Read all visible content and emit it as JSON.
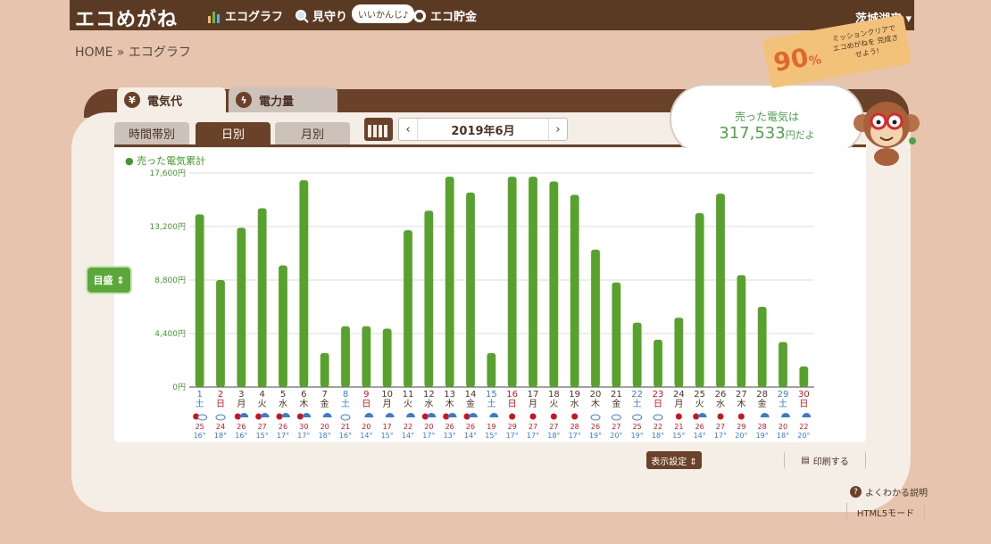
{
  "header": {
    "logo": "エコめがね",
    "nav": {
      "graph": "エコグラフ",
      "mimamori": "見守り",
      "mimamori_bubble": "いいかんじ♪",
      "savings": "エコ貯金"
    },
    "user": "茨城湖来 ▾"
  },
  "breadcrumb": "HOME » エコグラフ",
  "tabs": {
    "denki": "電気代",
    "power": "電力量"
  },
  "subtabs": {
    "time": "時間帯別",
    "day": "日別",
    "month": "月別"
  },
  "date_nav": {
    "prev": "‹",
    "label": "2019年6月",
    "next": "›"
  },
  "legend": "● 売った電気累計",
  "mokumori": "目盛 ⇕",
  "summary": {
    "line1": "売った電気は",
    "amount": "317,533",
    "unit": "円だよ"
  },
  "mission": {
    "percent": "90",
    "unit": "%",
    "message": "ミッションクリアで エコめがねを 完成させよう!"
  },
  "footer": {
    "display_settings": "表示設定 ⇕",
    "print": "印刷する",
    "help": "よくわかる説明",
    "html5": "HTML5モード"
  },
  "colors": {
    "bar": "#57a22d",
    "brown": "#6a4129",
    "sat": "#3a7bd5",
    "sun": "#d0121b",
    "high": "#d0121b",
    "low": "#3a7bd5"
  },
  "chart_data": {
    "type": "bar",
    "series": [
      {
        "name": "売った電気累計",
        "values": [
          14200,
          8800,
          13100,
          14700,
          10000,
          17000,
          2800,
          5000,
          5000,
          4800,
          12900,
          14500,
          17300,
          16000,
          2800,
          17300,
          17300,
          16900,
          15800,
          11300,
          8600,
          5300,
          3900,
          5700,
          14300,
          15900,
          9200,
          6600,
          3700,
          1700
        ]
      }
    ],
    "ylim": [
      0,
      17600
    ],
    "yticks": [
      "0円",
      "4,400円",
      "8,800円",
      "13,200円",
      "17,600円"
    ],
    "ytick_values": [
      0,
      4400,
      8800,
      13200,
      17600
    ],
    "days": [
      "1",
      "2",
      "3",
      "4",
      "5",
      "6",
      "7",
      "8",
      "9",
      "10",
      "11",
      "12",
      "13",
      "14",
      "15",
      "16",
      "17",
      "18",
      "19",
      "20",
      "21",
      "22",
      "23",
      "24",
      "25",
      "26",
      "27",
      "28",
      "29",
      "30"
    ],
    "weekdays": [
      "土",
      "日",
      "月",
      "火",
      "水",
      "木",
      "金",
      "土",
      "日",
      "月",
      "火",
      "水",
      "木",
      "金",
      "土",
      "日",
      "月",
      "火",
      "水",
      "木",
      "金",
      "土",
      "日",
      "月",
      "火",
      "水",
      "木",
      "金",
      "土",
      "日"
    ],
    "weather": [
      "sun-cloud",
      "cloud",
      "sun-umbrella",
      "sun-umbrella",
      "sun-umbrella",
      "sun-umbrella",
      "umbrella",
      "cloud",
      "umbrella",
      "umbrella",
      "umbrella",
      "sun-umbrella",
      "sun-umbrella",
      "sun-umbrella",
      "umbrella",
      "sun",
      "sun",
      "sun",
      "sun",
      "cloud",
      "cloud",
      "cloud",
      "cloud",
      "sun",
      "sun-umbrella",
      "sun",
      "sun",
      "umbrella",
      "umbrella",
      "umbrella"
    ],
    "high": [
      "25",
      "24",
      "26",
      "27",
      "26",
      "30",
      "20",
      "21",
      "20",
      "17",
      "22",
      "20",
      "26",
      "26",
      "19",
      "29",
      "27",
      "27",
      "28",
      "26",
      "27",
      "25",
      "22",
      "21",
      "26",
      "27",
      "29",
      "28",
      "20",
      "22"
    ],
    "low": [
      "16",
      "18",
      "16",
      "15",
      "17",
      "17",
      "18",
      "16",
      "14",
      "15",
      "14",
      "17",
      "13",
      "14",
      "15",
      "17",
      "17",
      "18",
      "17",
      "19",
      "20",
      "19",
      "18",
      "15",
      "14",
      "17",
      "20",
      "19",
      "18",
      "20"
    ],
    "temp_unit": "°"
  }
}
